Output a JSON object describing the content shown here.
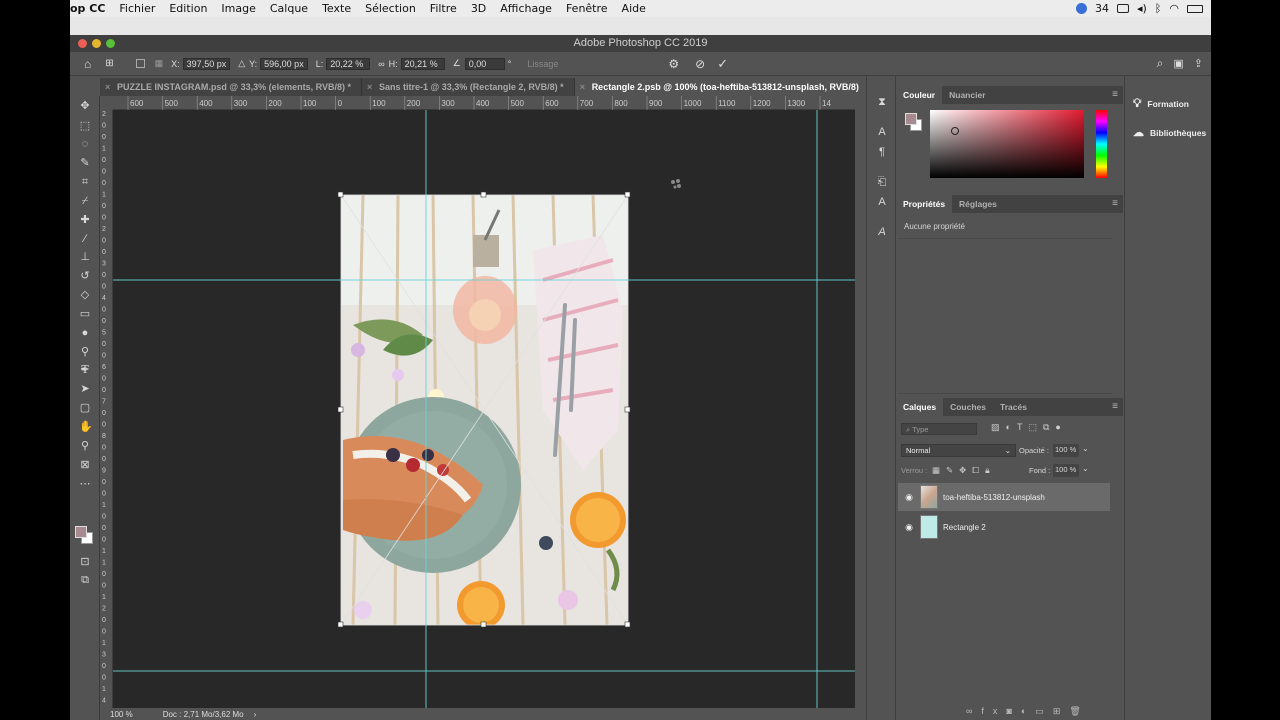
{
  "menubar": {
    "app": "op CC",
    "items": [
      "Fichier",
      "Edition",
      "Image",
      "Calque",
      "Texte",
      "Sélection",
      "Filtre",
      "3D",
      "Affichage",
      "Fenêtre",
      "Aide"
    ],
    "count": "34"
  },
  "window": {
    "title": "Adobe Photoshop CC 2019"
  },
  "options": {
    "x_label": "X:",
    "x_value": "397,50 px",
    "y_label": "Y:",
    "y_value": "596,00 px",
    "w_label": "L:",
    "w_value": "20,22 %",
    "h_label": "H:",
    "h_value": "20,21 %",
    "angle_value": "0,00",
    "angle_unit": "°",
    "smoothing": "Lissage"
  },
  "tabs": [
    {
      "label": "PUZZLE INSTAGRAM.psd @ 33,3% (elements, RVB/8) *",
      "active": false
    },
    {
      "label": "Sans titre-1 @ 33,3% (Rectangle 2, RVB/8) *",
      "active": false
    },
    {
      "label": "Rectangle 2.psb @ 100% (toa-heftiba-513812-unsplash, RVB/8)",
      "active": true
    }
  ],
  "ruler": {
    "h_ticks": [
      "600",
      "500",
      "400",
      "300",
      "200",
      "100",
      "0",
      "100",
      "200",
      "300",
      "400",
      "500",
      "600",
      "700",
      "800",
      "900",
      "1000",
      "1100",
      "1200",
      "1300",
      "14"
    ],
    "v_ticks": [
      "2",
      "0",
      "0",
      "1",
      "0",
      "0",
      "0",
      "1",
      "0",
      "0",
      "2",
      "0",
      "0",
      "3",
      "0",
      "0",
      "4",
      "0",
      "0",
      "5",
      "0",
      "0",
      "6",
      "0",
      "0",
      "7",
      "0",
      "0",
      "8",
      "0",
      "0",
      "9",
      "0",
      "0",
      "1",
      "0",
      "0",
      "0",
      "1",
      "1",
      "0",
      "0",
      "1",
      "2",
      "0",
      "0",
      "1",
      "3",
      "0",
      "0",
      "1",
      "4"
    ]
  },
  "status": {
    "zoom": "100 %",
    "doc": "Doc : 2,71 Mo/3,62 Mo",
    "arrow": "›"
  },
  "color_panel": {
    "tab1": "Couleur",
    "tab2": "Nuancier",
    "fg_color": "#a68a90",
    "bg_color": "#ffffff"
  },
  "properties_panel": {
    "tab1": "Propriétés",
    "tab2": "Réglages",
    "empty": "Aucune propriété"
  },
  "layers_panel": {
    "tab1": "Calques",
    "tab2": "Couches",
    "tab3": "Tracés",
    "filter_placeholder": "Type",
    "blend_mode": "Normal",
    "opacity_label": "Opacité :",
    "opacity_value": "100 %",
    "lock_label": "Verrou :",
    "fill_label": "Fond :",
    "fill_value": "100 %",
    "layers": [
      {
        "name": "toa-heftiba-513812-unsplash",
        "selected": true
      },
      {
        "name": "Rectangle 2",
        "selected": false
      }
    ]
  },
  "far_right": {
    "learn": "Formation",
    "libraries": "Bibliothèques"
  },
  "accent": {
    "guide": "#6ad3d6",
    "selected_layer": "#6a6a6a"
  }
}
